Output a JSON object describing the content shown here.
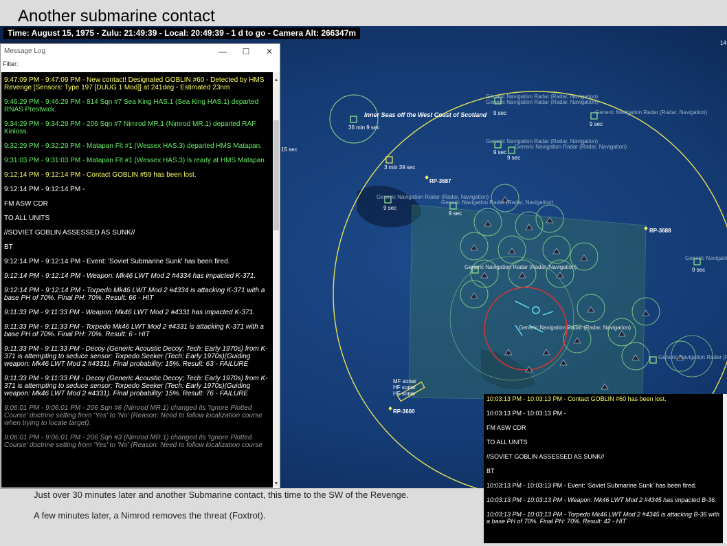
{
  "slide": {
    "title": "Another submarine contact",
    "caption1": "Just over 30 minutes later and another Submarine contact, this time to the SW of the Revenge.",
    "caption2": "A few minutes later, a Nimrod removes the threat (Foxtrot)."
  },
  "timebar": {
    "text": "Time: August 15, 1975 - Zulu: 21:49:39 - Local: 20:49:39 - 1 d to go -  Camera Alt: 266347m"
  },
  "message_log": {
    "title": "Message Log",
    "filter_label": "Filter:",
    "min_icon": "minimize-icon",
    "max_icon": "maximize-icon",
    "close_icon": "close-icon",
    "lines": [
      {
        "color": "yellow",
        "text": "9:47:09 PM - 9:47:09 PM - New contact! Designated GOBLIN #60 - Detected by HMS Revenge [Sensors: Type 197 [DUUG 1 Mod]] at 241deg - Estimated 23nm"
      },
      {
        "color": "green",
        "text": "9:46:29 PM - 9:46:29 PM - 814 Sqn #7 Sea King HAS.1 (Sea King HAS.1) departed RNAS Prestwick."
      },
      {
        "color": "green",
        "text": "9:34:29 PM - 9:34:29 PM - 206 Sqn #7 Nimrod MR.1 (Nimrod MR.1) departed RAF Kinloss."
      },
      {
        "color": "green",
        "text": "9:32:29 PM - 9:32:29 PM - Matapan Flt #1 (Wessex HAS.3) departed HMS Matapan."
      },
      {
        "color": "green",
        "text": "9:31:03 PM - 9:31:03 PM - Matapan Flt #1 (Wessex HAS.3) is ready at HMS Matapan"
      },
      {
        "color": "yellow",
        "text": "9:12:14 PM - 9:12:14 PM - Contact GOBLIN #59 has been lost."
      },
      {
        "color": "white",
        "text": "9:12:14 PM - 9:12:14 PM -"
      },
      {
        "color": "white",
        "text": "FM ASW CDR"
      },
      {
        "color": "white",
        "text": "TO ALL UNITS"
      },
      {
        "color": "white",
        "text": "//SOVIET GOBLIN ASSESSED AS SUNK//"
      },
      {
        "color": "white",
        "text": "BT"
      },
      {
        "color": "white",
        "text": " "
      },
      {
        "color": "white",
        "text": "9:12:14 PM - 9:12:14 PM - Event: 'Soviet Submarine Sunk' has been fired."
      },
      {
        "color": "italic",
        "text": "9:12:14 PM - 9:12:14 PM - Weapon: Mk46 LWT Mod 2 #4334 has impacted K-371."
      },
      {
        "color": "italic",
        "text": "9:12:14 PM - 9:12:14 PM - Torpedo Mk46 LWT Mod 2 #4334 is attacking K-371 with a base PH of 70%. Final PH: 70%. Result: 66 - HIT"
      },
      {
        "color": "italic",
        "text": "9:11:33 PM - 9:11:33 PM - Weapon: Mk46 LWT Mod 2 #4331 has impacted K-371."
      },
      {
        "color": "italic",
        "text": "9:11:33 PM - 9:11:33 PM - Torpedo Mk46 LWT Mod 2 #4331 is attacking K-371 with a base PH of 70%. Final PH: 70%. Result: 6 - HIT"
      },
      {
        "color": "italic",
        "text": "9:11:33 PM - 9:11:33 PM - Decoy (Generic Acoustic Decoy; Tech: Early 1970s) from K-371 is attempting to seduce sensor: Torpedo Seeker (Tech: Early 1970s)(Guiding weapon: Mk46 LWT Mod 2 #4331). Final probability: 15%. Result: 63 - FAILURE"
      },
      {
        "color": "italic",
        "text": "9:11:33 PM - 9:11:33 PM - Decoy (Generic Acoustic Decoy; Tech: Early 1970s) from K-371 is attempting to seduce sensor: Torpedo Seeker (Tech: Early 1970s)(Guiding weapon: Mk46 LWT Mod 2 #4331). Final probability: 15%. Result: 76 - FAILURE"
      },
      {
        "color": "gray",
        "text": "9:06:01 PM - 9:06:01 PM - 206 Sqn #6 (Nimrod MR.1) changed its 'Ignore Plotted Course' doctrine setting from 'Yes' to 'No' (Reason: Need to follow localization course when trying to locate target)."
      },
      {
        "color": "gray",
        "text": "9:06:01 PM - 9:06:01 PM - 206 Sqn #3 (Nimrod MR.1) changed its 'Ignore Plotted Course' doctrine setting from 'Yes' to 'No' (Reason: Need to follow localization course"
      }
    ]
  },
  "inset_log": {
    "lines": [
      {
        "color": "yellow",
        "text": "10:03:13 PM - 10:03:13 PM - Contact GOBLIN #60 has been lost."
      },
      {
        "color": "white",
        "text": "10:03:13 PM - 10:03:13 PM -"
      },
      {
        "color": "white",
        "text": "FM ASW CDR"
      },
      {
        "color": "white",
        "text": "TO ALL UNITS"
      },
      {
        "color": "white",
        "text": "//SOVIET GOBLIN ASSESSED AS SUNK//"
      },
      {
        "color": "white",
        "text": "BT"
      },
      {
        "color": "white",
        "text": " "
      },
      {
        "color": "white",
        "text": "10:03:13 PM - 10:03:13 PM - Event: 'Soviet Submarine Sunk' has been fired."
      },
      {
        "color": "italic",
        "text": "10:03:13 PM - 10:03:13 PM - Weapon: Mk46 LWT Mod 2 #4345 has impacted B-36."
      },
      {
        "color": "italic",
        "text": "10:03:13 PM - 10:03:13 PM - Torpedo Mk46 LWT Mod 2 #4345 is attacking B-36 with a base PH of 70%. Final PH: 70%. Result: 42 - HIT"
      }
    ]
  },
  "map": {
    "region_label": "Inner Seas off the West Coast of Scotland",
    "ref_points": [
      "RP-3687",
      "RP-3688",
      "RP-3600"
    ],
    "timers": [
      "36 min 9 sec",
      "3 min 39 sec",
      "9 sec",
      "15 sec",
      "14"
    ],
    "radar_label": "Generic Navigation Radar (Radar, Navigation)",
    "sonar_labels": [
      "MF sonar",
      "HF sonar",
      "HF sonar"
    ],
    "colors": {
      "ocean": "#0f2c5a",
      "range_ring": "#e6e35a",
      "friendly": "#8fe08f",
      "contact": "#dd3333"
    }
  }
}
